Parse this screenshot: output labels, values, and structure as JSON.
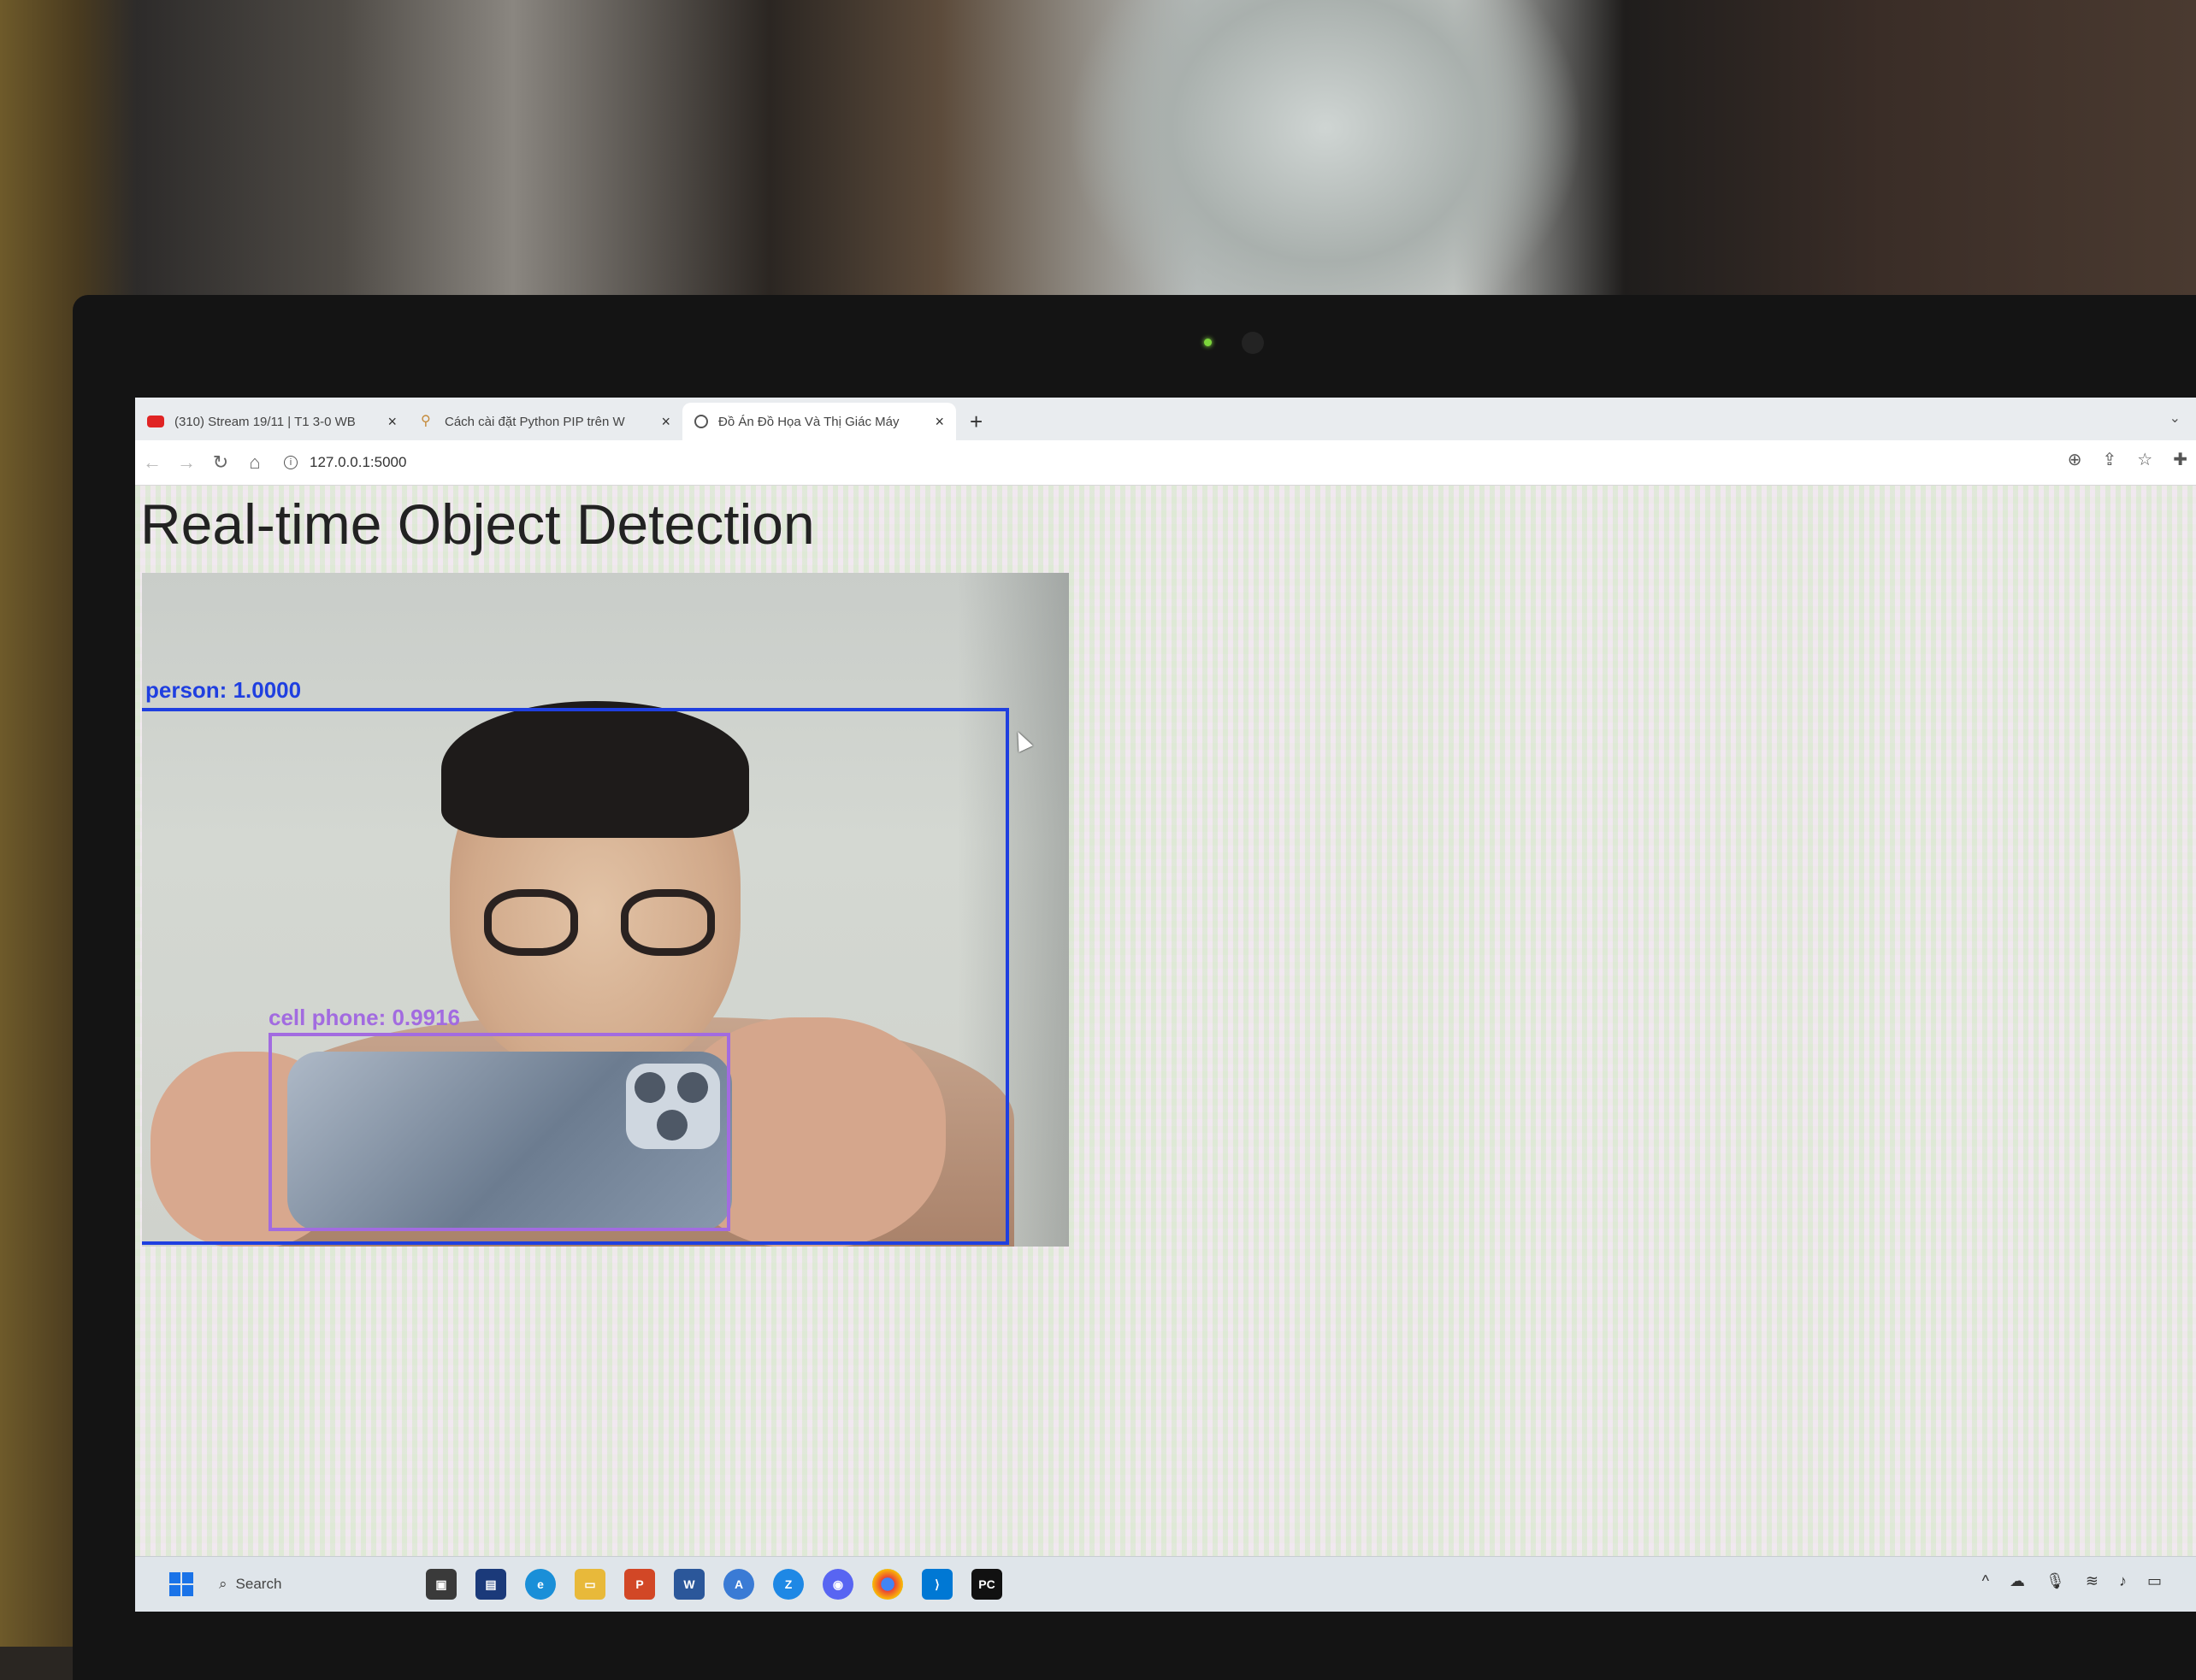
{
  "browser": {
    "tabs": [
      {
        "title": "(310) Stream 19/11 | T1 3-0 WB",
        "favicon": "youtube-icon",
        "active": false
      },
      {
        "title": "Cách cài đặt Python PIP trên W",
        "favicon": "pip-icon",
        "active": false
      },
      {
        "title": "Đồ Án Đồ Họa Và Thị Giác Máy",
        "favicon": "globe-icon",
        "active": true
      }
    ],
    "new_tab": "+",
    "url": "127.0.0.1:5000"
  },
  "page": {
    "title": "Real-time Object Detection"
  },
  "detections": [
    {
      "label": "person: 1.0000",
      "color": "#1f3fe0"
    },
    {
      "label": "cell phone: 0.9916",
      "color": "#a26be0"
    }
  ],
  "taskbar": {
    "search_placeholder": "Search",
    "apps": [
      "file-explorer-icon",
      "edge-icon",
      "folder-icon",
      "powerpoint-icon",
      "word-icon",
      "app-store-icon",
      "zalo-icon",
      "discord-icon",
      "chrome-icon",
      "vscode-icon",
      "pycharm-icon"
    ]
  }
}
